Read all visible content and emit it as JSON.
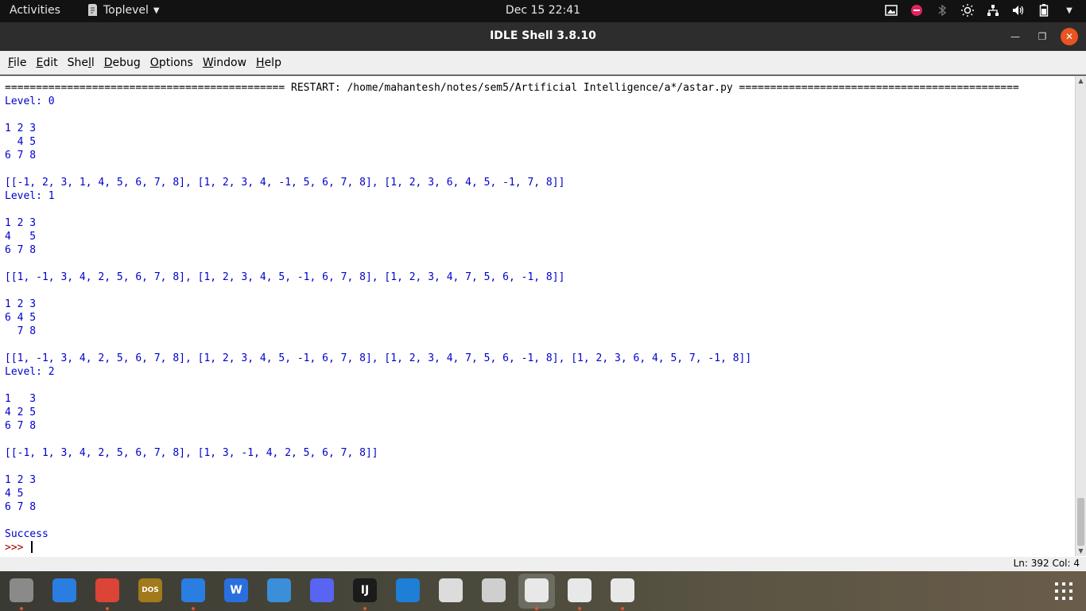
{
  "topbar": {
    "activities": "Activities",
    "app_menu": "Toplevel",
    "clock": "Dec 15  22:41",
    "tray_icons": [
      "screenshot-icon",
      "dnd-icon",
      "bluetooth-icon",
      "brightness-icon",
      "network-icon",
      "volume-icon",
      "battery-icon"
    ]
  },
  "window": {
    "title": "IDLE Shell 3.8.10"
  },
  "menubar": {
    "items": [
      {
        "pre": "",
        "ul": "F",
        "post": "ile"
      },
      {
        "pre": "",
        "ul": "E",
        "post": "dit"
      },
      {
        "pre": "She",
        "ul": "l",
        "post": "l"
      },
      {
        "pre": "",
        "ul": "D",
        "post": "ebug"
      },
      {
        "pre": "",
        "ul": "O",
        "post": "ptions"
      },
      {
        "pre": "",
        "ul": "W",
        "post": "indow"
      },
      {
        "pre": "",
        "ul": "H",
        "post": "elp"
      }
    ]
  },
  "shell": {
    "lines": [
      "============================================= RESTART: /home/mahantesh/notes/sem5/Artificial Intelligence/a*/astar.py =============================================",
      "Level: 0",
      "",
      "1 2 3",
      "  4 5",
      "6 7 8",
      "",
      "[[-1, 2, 3, 1, 4, 5, 6, 7, 8], [1, 2, 3, 4, -1, 5, 6, 7, 8], [1, 2, 3, 6, 4, 5, -1, 7, 8]]",
      "Level: 1",
      "",
      "1 2 3",
      "4   5",
      "6 7 8",
      "",
      "[[1, -1, 3, 4, 2, 5, 6, 7, 8], [1, 2, 3, 4, 5, -1, 6, 7, 8], [1, 2, 3, 4, 7, 5, 6, -1, 8]]",
      "",
      "1 2 3",
      "6 4 5",
      "  7 8",
      "",
      "[[1, -1, 3, 4, 2, 5, 6, 7, 8], [1, 2, 3, 4, 5, -1, 6, 7, 8], [1, 2, 3, 4, 7, 5, 6, -1, 8], [1, 2, 3, 6, 4, 5, 7, -1, 8]]",
      "Level: 2",
      "",
      "1   3",
      "4 2 5",
      "6 7 8",
      "",
      "[[-1, 1, 3, 4, 2, 5, 6, 7, 8], [1, 3, -1, 4, 2, 5, 6, 7, 8]]",
      "",
      "1 2 3",
      "4 5",
      "6 7 8",
      "",
      "Success"
    ],
    "prompt": ">>> "
  },
  "status": {
    "position": "Ln: 392   Col: 4"
  },
  "dock": {
    "apps": [
      {
        "name": "files-icon",
        "label": "",
        "color": "#8a8a8a",
        "running": true
      },
      {
        "name": "text-editor-icon",
        "label": "",
        "color": "#2a7de1",
        "running": false
      },
      {
        "name": "chrome-icon",
        "label": "",
        "color": "#db4437",
        "running": true
      },
      {
        "name": "dosbox-icon",
        "label": "DOS",
        "color": "#a07a1c",
        "running": false
      },
      {
        "name": "remote-desktop-icon",
        "label": "",
        "color": "#2a7de1",
        "running": true
      },
      {
        "name": "wps-office-icon",
        "label": "W",
        "color": "#2a6fe0",
        "running": false
      },
      {
        "name": "system-monitor-icon",
        "label": "",
        "color": "#3a8fd8",
        "running": false
      },
      {
        "name": "discord-icon",
        "label": "",
        "color": "#5865f2",
        "running": false
      },
      {
        "name": "intellij-icon",
        "label": "IJ",
        "color": "#1b1b1b",
        "running": true
      },
      {
        "name": "vscode-icon",
        "label": "",
        "color": "#1e7fd6",
        "running": false
      },
      {
        "name": "document-viewer-icon",
        "label": "",
        "color": "#dcdcdc",
        "running": false
      },
      {
        "name": "image-viewer-icon",
        "label": "",
        "color": "#cfcfcf",
        "running": false
      },
      {
        "name": "idle-python-icon-1",
        "label": "",
        "color": "#e8e8e8",
        "running": true
      },
      {
        "name": "idle-python-icon-2",
        "label": "",
        "color": "#e8e8e8",
        "running": true
      },
      {
        "name": "idle-python-icon-3",
        "label": "",
        "color": "#e8e8e8",
        "running": true
      }
    ]
  }
}
